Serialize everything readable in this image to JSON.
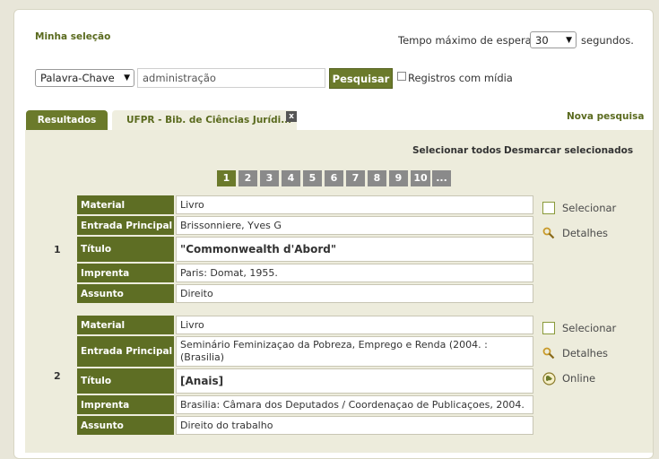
{
  "header": {
    "my_selection": "Minha seleção",
    "wait_label": "Tempo máximo de espera",
    "wait_value": "30",
    "wait_suffix": "segundos."
  },
  "search": {
    "field_select": "Palavra-Chave",
    "query": "administração",
    "button": "Pesquisar",
    "media_label": "Registros com mídia"
  },
  "tabs": {
    "results": "Resultados",
    "library": "UFPR - Bib. de Ciências Jurídi...",
    "close": "x",
    "new_search": "Nova pesquisa"
  },
  "selection": {
    "select_all": "Selecionar todos",
    "deselect": "Desmarcar selecionados"
  },
  "pagination": [
    "1",
    "2",
    "3",
    "4",
    "5",
    "6",
    "7",
    "8",
    "9",
    "10",
    "..."
  ],
  "labels": {
    "material": "Material",
    "entrada": "Entrada Principal",
    "titulo": "Título",
    "imprenta": "Imprenta",
    "assunto": "Assunto"
  },
  "actions": {
    "select": "Selecionar",
    "details": "Detalhes",
    "online": "Online"
  },
  "records": [
    {
      "number": "1",
      "material": "Livro",
      "entrada": "Brissonniere, Yves G",
      "titulo": "\"Commonwealth d'Abord\"",
      "imprenta": "Paris: Domat, 1955.",
      "assunto": "Direito"
    },
    {
      "number": "2",
      "material": "Livro",
      "entrada": "Seminário Feminizaçao da Pobreza, Emprego e Renda (2004. : (Brasilia)",
      "titulo": "[Anais]",
      "imprenta": "Brasilia: Câmara dos Deputados / Coordenaçao de Publicaçoes, 2004.",
      "assunto": "Direito do trabalho"
    }
  ],
  "colors": {
    "olive": "#6b7a2b",
    "label_bg": "#5e6e24",
    "results_bg": "#edecdc",
    "page_bg": "#e8e6d9"
  }
}
